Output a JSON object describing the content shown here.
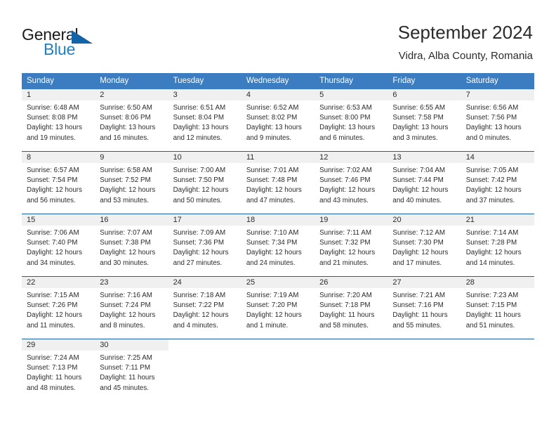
{
  "logo": {
    "word_one": "General",
    "word_two": "Blue",
    "icon": "triangle-logo-icon",
    "accent_color": "#1263a8",
    "blue_text_color": "#1f7fc4"
  },
  "header": {
    "title": "September 2024",
    "subtitle": "Vidra, Alba County, Romania"
  },
  "colors": {
    "header_band": "#3b7dc0",
    "row_divider": "#1b5fa5",
    "day_band": "#f0f0f0",
    "text": "#2b2b2b"
  },
  "weekdays": [
    "Sunday",
    "Monday",
    "Tuesday",
    "Wednesday",
    "Thursday",
    "Friday",
    "Saturday"
  ],
  "weeks": [
    {
      "days": [
        {
          "number": "1",
          "sunrise": "Sunrise: 6:48 AM",
          "sunset": "Sunset: 8:08 PM",
          "daylight_line1": "Daylight: 13 hours",
          "daylight_line2": "and 19 minutes."
        },
        {
          "number": "2",
          "sunrise": "Sunrise: 6:50 AM",
          "sunset": "Sunset: 8:06 PM",
          "daylight_line1": "Daylight: 13 hours",
          "daylight_line2": "and 16 minutes."
        },
        {
          "number": "3",
          "sunrise": "Sunrise: 6:51 AM",
          "sunset": "Sunset: 8:04 PM",
          "daylight_line1": "Daylight: 13 hours",
          "daylight_line2": "and 12 minutes."
        },
        {
          "number": "4",
          "sunrise": "Sunrise: 6:52 AM",
          "sunset": "Sunset: 8:02 PM",
          "daylight_line1": "Daylight: 13 hours",
          "daylight_line2": "and 9 minutes."
        },
        {
          "number": "5",
          "sunrise": "Sunrise: 6:53 AM",
          "sunset": "Sunset: 8:00 PM",
          "daylight_line1": "Daylight: 13 hours",
          "daylight_line2": "and 6 minutes."
        },
        {
          "number": "6",
          "sunrise": "Sunrise: 6:55 AM",
          "sunset": "Sunset: 7:58 PM",
          "daylight_line1": "Daylight: 13 hours",
          "daylight_line2": "and 3 minutes."
        },
        {
          "number": "7",
          "sunrise": "Sunrise: 6:56 AM",
          "sunset": "Sunset: 7:56 PM",
          "daylight_line1": "Daylight: 13 hours",
          "daylight_line2": "and 0 minutes."
        }
      ]
    },
    {
      "days": [
        {
          "number": "8",
          "sunrise": "Sunrise: 6:57 AM",
          "sunset": "Sunset: 7:54 PM",
          "daylight_line1": "Daylight: 12 hours",
          "daylight_line2": "and 56 minutes."
        },
        {
          "number": "9",
          "sunrise": "Sunrise: 6:58 AM",
          "sunset": "Sunset: 7:52 PM",
          "daylight_line1": "Daylight: 12 hours",
          "daylight_line2": "and 53 minutes."
        },
        {
          "number": "10",
          "sunrise": "Sunrise: 7:00 AM",
          "sunset": "Sunset: 7:50 PM",
          "daylight_line1": "Daylight: 12 hours",
          "daylight_line2": "and 50 minutes."
        },
        {
          "number": "11",
          "sunrise": "Sunrise: 7:01 AM",
          "sunset": "Sunset: 7:48 PM",
          "daylight_line1": "Daylight: 12 hours",
          "daylight_line2": "and 47 minutes."
        },
        {
          "number": "12",
          "sunrise": "Sunrise: 7:02 AM",
          "sunset": "Sunset: 7:46 PM",
          "daylight_line1": "Daylight: 12 hours",
          "daylight_line2": "and 43 minutes."
        },
        {
          "number": "13",
          "sunrise": "Sunrise: 7:04 AM",
          "sunset": "Sunset: 7:44 PM",
          "daylight_line1": "Daylight: 12 hours",
          "daylight_line2": "and 40 minutes."
        },
        {
          "number": "14",
          "sunrise": "Sunrise: 7:05 AM",
          "sunset": "Sunset: 7:42 PM",
          "daylight_line1": "Daylight: 12 hours",
          "daylight_line2": "and 37 minutes."
        }
      ]
    },
    {
      "days": [
        {
          "number": "15",
          "sunrise": "Sunrise: 7:06 AM",
          "sunset": "Sunset: 7:40 PM",
          "daylight_line1": "Daylight: 12 hours",
          "daylight_line2": "and 34 minutes."
        },
        {
          "number": "16",
          "sunrise": "Sunrise: 7:07 AM",
          "sunset": "Sunset: 7:38 PM",
          "daylight_line1": "Daylight: 12 hours",
          "daylight_line2": "and 30 minutes."
        },
        {
          "number": "17",
          "sunrise": "Sunrise: 7:09 AM",
          "sunset": "Sunset: 7:36 PM",
          "daylight_line1": "Daylight: 12 hours",
          "daylight_line2": "and 27 minutes."
        },
        {
          "number": "18",
          "sunrise": "Sunrise: 7:10 AM",
          "sunset": "Sunset: 7:34 PM",
          "daylight_line1": "Daylight: 12 hours",
          "daylight_line2": "and 24 minutes."
        },
        {
          "number": "19",
          "sunrise": "Sunrise: 7:11 AM",
          "sunset": "Sunset: 7:32 PM",
          "daylight_line1": "Daylight: 12 hours",
          "daylight_line2": "and 21 minutes."
        },
        {
          "number": "20",
          "sunrise": "Sunrise: 7:12 AM",
          "sunset": "Sunset: 7:30 PM",
          "daylight_line1": "Daylight: 12 hours",
          "daylight_line2": "and 17 minutes."
        },
        {
          "number": "21",
          "sunrise": "Sunrise: 7:14 AM",
          "sunset": "Sunset: 7:28 PM",
          "daylight_line1": "Daylight: 12 hours",
          "daylight_line2": "and 14 minutes."
        }
      ]
    },
    {
      "days": [
        {
          "number": "22",
          "sunrise": "Sunrise: 7:15 AM",
          "sunset": "Sunset: 7:26 PM",
          "daylight_line1": "Daylight: 12 hours",
          "daylight_line2": "and 11 minutes."
        },
        {
          "number": "23",
          "sunrise": "Sunrise: 7:16 AM",
          "sunset": "Sunset: 7:24 PM",
          "daylight_line1": "Daylight: 12 hours",
          "daylight_line2": "and 8 minutes."
        },
        {
          "number": "24",
          "sunrise": "Sunrise: 7:18 AM",
          "sunset": "Sunset: 7:22 PM",
          "daylight_line1": "Daylight: 12 hours",
          "daylight_line2": "and 4 minutes."
        },
        {
          "number": "25",
          "sunrise": "Sunrise: 7:19 AM",
          "sunset": "Sunset: 7:20 PM",
          "daylight_line1": "Daylight: 12 hours",
          "daylight_line2": "and 1 minute."
        },
        {
          "number": "26",
          "sunrise": "Sunrise: 7:20 AM",
          "sunset": "Sunset: 7:18 PM",
          "daylight_line1": "Daylight: 11 hours",
          "daylight_line2": "and 58 minutes."
        },
        {
          "number": "27",
          "sunrise": "Sunrise: 7:21 AM",
          "sunset": "Sunset: 7:16 PM",
          "daylight_line1": "Daylight: 11 hours",
          "daylight_line2": "and 55 minutes."
        },
        {
          "number": "28",
          "sunrise": "Sunrise: 7:23 AM",
          "sunset": "Sunset: 7:15 PM",
          "daylight_line1": "Daylight: 11 hours",
          "daylight_line2": "and 51 minutes."
        }
      ]
    },
    {
      "days": [
        {
          "number": "29",
          "sunrise": "Sunrise: 7:24 AM",
          "sunset": "Sunset: 7:13 PM",
          "daylight_line1": "Daylight: 11 hours",
          "daylight_line2": "and 48 minutes."
        },
        {
          "number": "30",
          "sunrise": "Sunrise: 7:25 AM",
          "sunset": "Sunset: 7:11 PM",
          "daylight_line1": "Daylight: 11 hours",
          "daylight_line2": "and 45 minutes."
        },
        {
          "number": "",
          "sunrise": "",
          "sunset": "",
          "daylight_line1": "",
          "daylight_line2": ""
        },
        {
          "number": "",
          "sunrise": "",
          "sunset": "",
          "daylight_line1": "",
          "daylight_line2": ""
        },
        {
          "number": "",
          "sunrise": "",
          "sunset": "",
          "daylight_line1": "",
          "daylight_line2": ""
        },
        {
          "number": "",
          "sunrise": "",
          "sunset": "",
          "daylight_line1": "",
          "daylight_line2": ""
        },
        {
          "number": "",
          "sunrise": "",
          "sunset": "",
          "daylight_line1": "",
          "daylight_line2": ""
        }
      ]
    }
  ]
}
